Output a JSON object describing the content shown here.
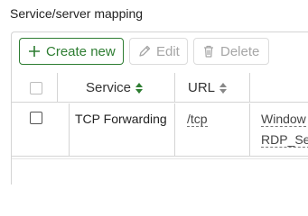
{
  "section": {
    "title": "Service/server mapping"
  },
  "toolbar": {
    "create_label": "Create new",
    "edit_label": "Edit",
    "delete_label": "Delete"
  },
  "table": {
    "columns": [
      "Service",
      "URL"
    ],
    "rows": [
      {
        "service": "TCP Forwarding",
        "url": "/tcp",
        "server_line1": "Window",
        "server_line2": "RDP_Se"
      }
    ]
  },
  "colors": {
    "accent": "#2e7d32",
    "disabled": "#a6a6a6",
    "border": "#d4d4d4"
  },
  "icons": [
    "plus-icon",
    "pencil-icon",
    "trash-icon",
    "sort-icon"
  ]
}
